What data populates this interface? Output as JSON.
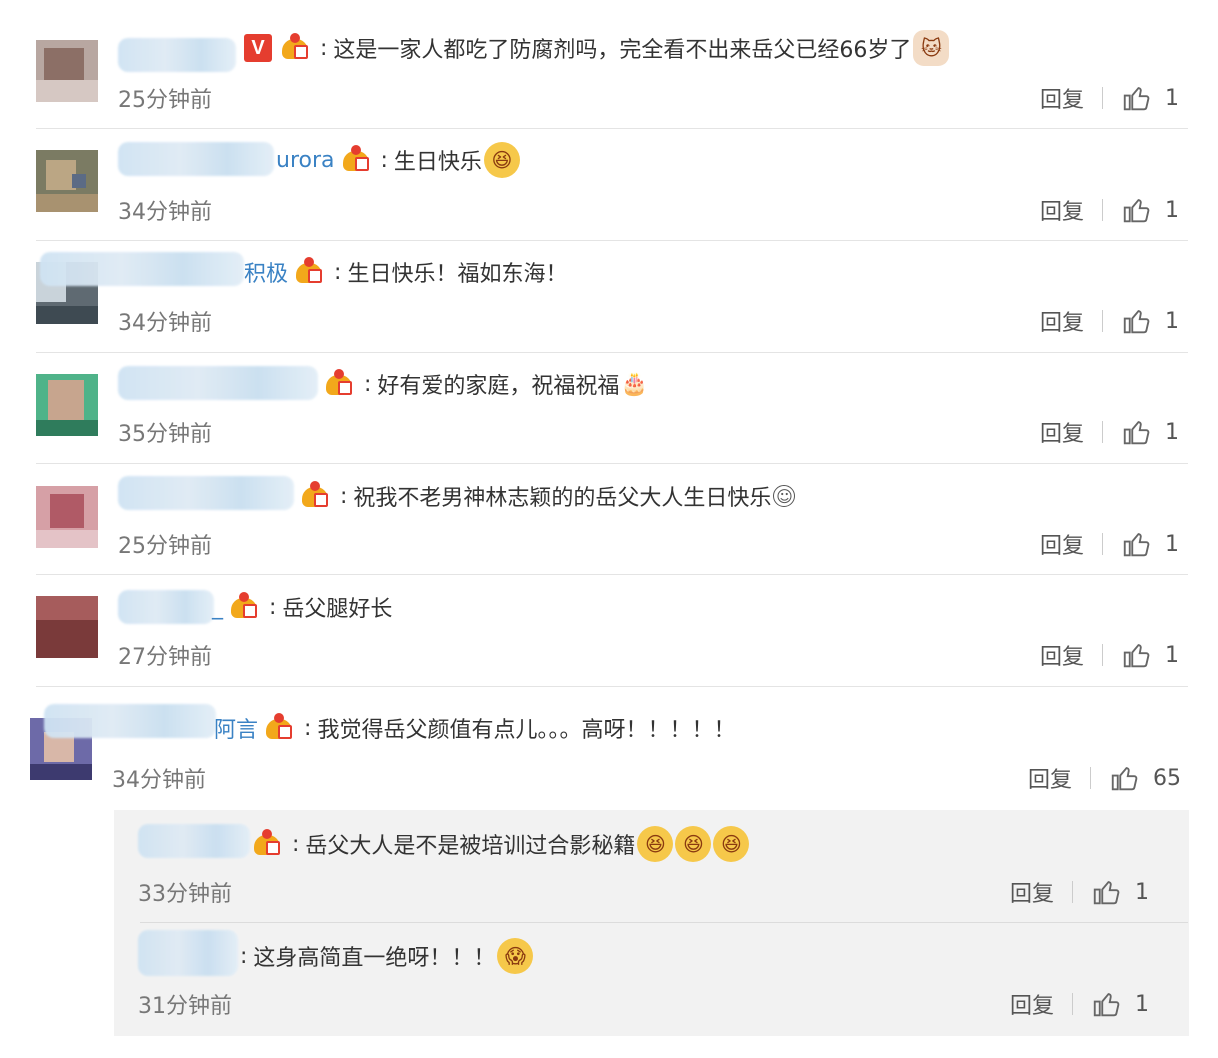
{
  "reply_label": "回复",
  "colors": {
    "name_link": "#3a82c4",
    "vip_badge": "#e53d2f",
    "crown": "#f2a81b",
    "divider": "#e4e4e4",
    "sub_panel": "#f2f2f2"
  },
  "comments": [
    {
      "name_tail": "",
      "verified_badge": "V",
      "text": "这是一家人都吃了防腐剂吗，完全看不出来岳父已经66岁了",
      "emoji": "cat-face-icon",
      "time": "25分钟前",
      "likes": "1"
    },
    {
      "name_tail": "urora",
      "text": "生日快乐",
      "emoji": "laughing-face-icon",
      "time": "34分钟前",
      "likes": "1"
    },
    {
      "name_tail": "积极",
      "text": "生日快乐！福如东海！",
      "time": "34分钟前",
      "likes": "1"
    },
    {
      "name_tail": "",
      "text": "好有爱的家庭，祝福祝福",
      "emoji": "cake-icon",
      "time": "35分钟前",
      "likes": "1"
    },
    {
      "name_tail": "",
      "text": "祝我不老男神林志颖的的岳父大人生日快乐",
      "emoji": "smile-icon",
      "time": "25分钟前",
      "likes": "1"
    },
    {
      "name_tail": "_",
      "text": "岳父腿好长",
      "time": "27分钟前",
      "likes": "1"
    },
    {
      "name_tail": "阿言",
      "text": "我觉得岳父颜值有点儿。。。高呀！！！！！",
      "time": "34分钟前",
      "likes": "65"
    }
  ],
  "replies": [
    {
      "text": "岳父大人是不是被培训过合影秘籍",
      "emoji": "laughing-face-icon",
      "time": "33分钟前",
      "likes": "1"
    },
    {
      "text": "这身高简直一绝呀！！！",
      "emoji": "shocked-face-icon",
      "time": "31分钟前",
      "likes": "1"
    }
  ]
}
